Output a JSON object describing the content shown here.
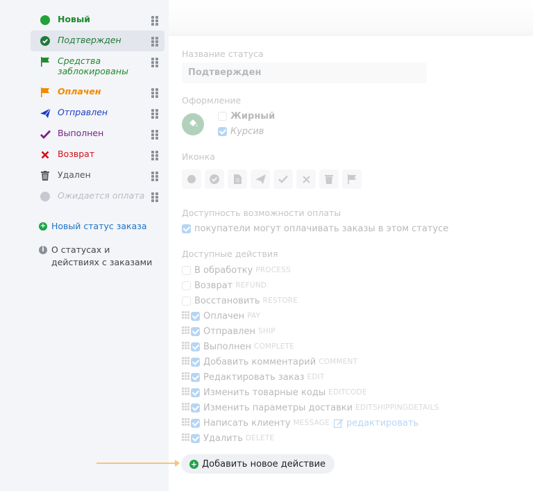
{
  "sidebar": {
    "statuses": [
      {
        "label": "Новый",
        "icon": "green-circle-icon",
        "color": "#1f8a2e",
        "bold": true,
        "italic": false,
        "selected": false
      },
      {
        "label": "Подтвержден",
        "icon": "check-circle-icon",
        "color": "#1f7a3a",
        "bold": false,
        "italic": true,
        "selected": true
      },
      {
        "label": "Средства заблокированы",
        "icon": "flag-icon",
        "color": "#1f8a2e",
        "bold": false,
        "italic": true,
        "selected": false
      },
      {
        "label": "Оплачен",
        "icon": "flag-icon",
        "color": "#f08a00",
        "bold": true,
        "italic": true,
        "selected": false
      },
      {
        "label": "Отправлен",
        "icon": "paper-plane-icon",
        "color": "#1d3fc4",
        "bold": false,
        "italic": true,
        "selected": false
      },
      {
        "label": "Выполнен",
        "icon": "checkmark-icon",
        "color": "#7a1f86",
        "bold": false,
        "italic": false,
        "selected": false
      },
      {
        "label": "Возврат",
        "icon": "cross-icon",
        "color": "#d0101a",
        "bold": false,
        "italic": false,
        "selected": false
      },
      {
        "label": "Удален",
        "icon": "trash-icon",
        "color": "#555555",
        "bold": false,
        "italic": false,
        "selected": false
      },
      {
        "label": "Ожидается оплата",
        "icon": "grey-circle-icon",
        "color": "#b8bcc4",
        "bold": false,
        "italic": true,
        "selected": false
      }
    ],
    "new_status_link": "Новый статус заказа",
    "info_link": "О статусах и действиях с заказами"
  },
  "form": {
    "name_label": "Название статуса",
    "name_value": "Подтвержден",
    "style_label": "Оформление",
    "bold_label": "Жирный",
    "bold_checked": false,
    "italic_label": "Курсив",
    "italic_checked": true,
    "icon_label": "Иконка",
    "icons": [
      "circle-icon",
      "check-circle-icon",
      "document-icon",
      "paper-plane-icon",
      "checkmark-icon",
      "cross-icon",
      "trash-icon",
      "flag-icon"
    ],
    "payment_label": "Доступность возможности оплаты",
    "payment_option": "покупатели могут оплачивать заказы в этом статусе",
    "payment_checked": true,
    "actions_label": "Доступные действия",
    "actions": [
      {
        "label": "В обработку",
        "code": "PROCESS",
        "checked": false,
        "draggable": false
      },
      {
        "label": "Возврат",
        "code": "REFUND",
        "checked": false,
        "draggable": false
      },
      {
        "label": "Восстановить",
        "code": "RESTORE",
        "checked": false,
        "draggable": false
      },
      {
        "label": "Оплачен",
        "code": "PAY",
        "checked": true,
        "draggable": true
      },
      {
        "label": "Отправлен",
        "code": "SHIP",
        "checked": true,
        "draggable": true
      },
      {
        "label": "Выполнен",
        "code": "COMPLETE",
        "checked": true,
        "draggable": true
      },
      {
        "label": "Добавить комментарий",
        "code": "COMMENT",
        "checked": true,
        "draggable": true
      },
      {
        "label": "Редактировать заказ",
        "code": "EDIT",
        "checked": true,
        "draggable": true
      },
      {
        "label": "Изменить товарные коды",
        "code": "EDITCODE",
        "checked": true,
        "draggable": true
      },
      {
        "label": "Изменить параметры доставки",
        "code": "EDITSHIPPINGDETAILS",
        "checked": true,
        "draggable": true
      },
      {
        "label": "Написать клиенту",
        "code": "MESSAGE",
        "checked": true,
        "draggable": true,
        "edit_link": "редактировать"
      },
      {
        "label": "Удалить",
        "code": "DELETE",
        "checked": true,
        "draggable": true
      }
    ],
    "add_action_label": "Добавить новое действие"
  },
  "colors": {
    "accent_blue": "#2b86e0",
    "add_green": "#1fa34a",
    "highlight_arrow": "#f0c779"
  }
}
